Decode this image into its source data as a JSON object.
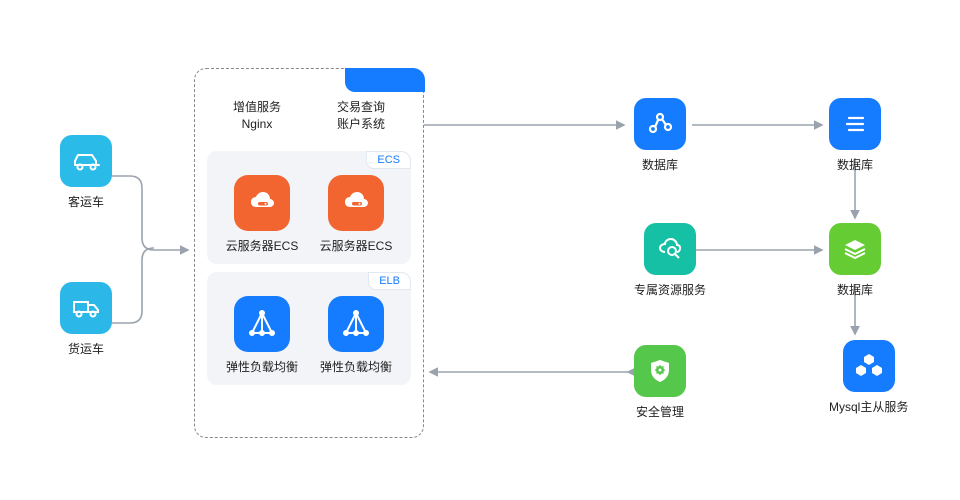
{
  "left": {
    "car": {
      "label": "客运车"
    },
    "truck": {
      "label": "货运车"
    }
  },
  "main": {
    "tab": "",
    "tab_left": {
      "line1": "增值服务",
      "line2": "Nginx"
    },
    "tab_right": {
      "line1": "交易查询",
      "line2": "账户系统"
    },
    "ecs": {
      "badge": "ECS",
      "item1": "云服务器ECS",
      "item2": "云服务器ECS"
    },
    "elb": {
      "badge": "ELB",
      "item1": "弹性负载均衡",
      "item2": "弹性负载均衡"
    }
  },
  "right": {
    "share": {
      "label": "数据库"
    },
    "list": {
      "label": "数据库"
    },
    "search": {
      "label": "专属资源服务"
    },
    "shield": {
      "label": "安全管理"
    },
    "stack": {
      "label": "数据库"
    },
    "hex": {
      "label": "Mysql主从服务"
    }
  }
}
